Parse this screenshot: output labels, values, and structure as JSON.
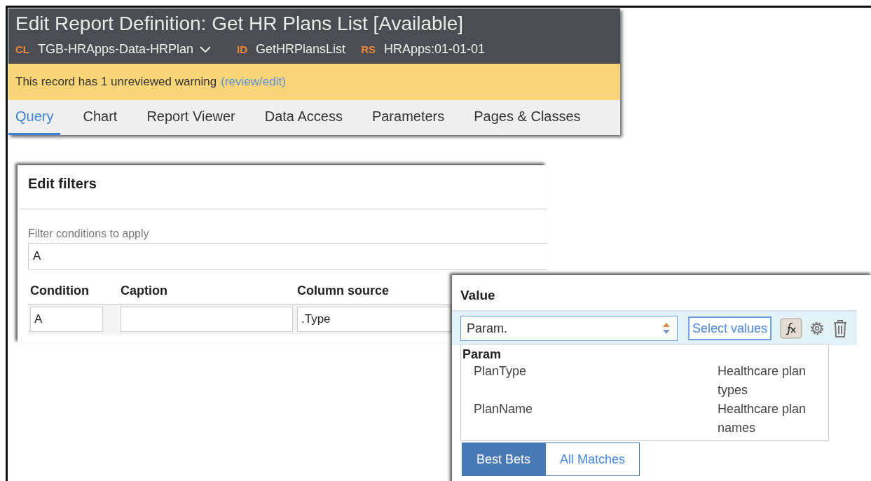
{
  "header": {
    "title": "Edit Report Definition: Get HR Plans List [Available]",
    "meta": [
      {
        "key": "CL",
        "value": "TGB-HRApps-Data-HRPlan",
        "dropdown": true
      },
      {
        "key": "ID",
        "value": "GetHRPlansList",
        "dropdown": false
      },
      {
        "key": "RS",
        "value": "HRApps:01-01-01",
        "dropdown": false
      }
    ]
  },
  "warning": {
    "text": "This record has 1 unreviewed warning",
    "link": "(review/edit)"
  },
  "tabs": [
    {
      "label": "Query",
      "selected": true
    },
    {
      "label": "Chart",
      "selected": false
    },
    {
      "label": "Report Viewer",
      "selected": false
    },
    {
      "label": "Data Access",
      "selected": false
    },
    {
      "label": "Parameters",
      "selected": false
    },
    {
      "label": "Pages & Classes",
      "selected": false
    }
  ],
  "filters": {
    "title": "Edit filters",
    "conditions_label": "Filter conditions to apply",
    "conditions_value": "A",
    "columns": [
      "Condition",
      "Caption",
      "Column source"
    ],
    "row": {
      "condition": "A",
      "column_source": ".Type"
    }
  },
  "value_panel": {
    "title": "Value",
    "input_value": "Param.",
    "select_button": "Select values",
    "suggestions": {
      "group": "Param",
      "items": [
        {
          "name": "PlanType",
          "description": "Healthcare plan types"
        },
        {
          "name": "PlanName",
          "description": "Healthcare plan names"
        }
      ]
    },
    "tabs": [
      {
        "label": "Best Bets",
        "selected": true
      },
      {
        "label": "All Matches",
        "selected": false
      }
    ]
  }
}
